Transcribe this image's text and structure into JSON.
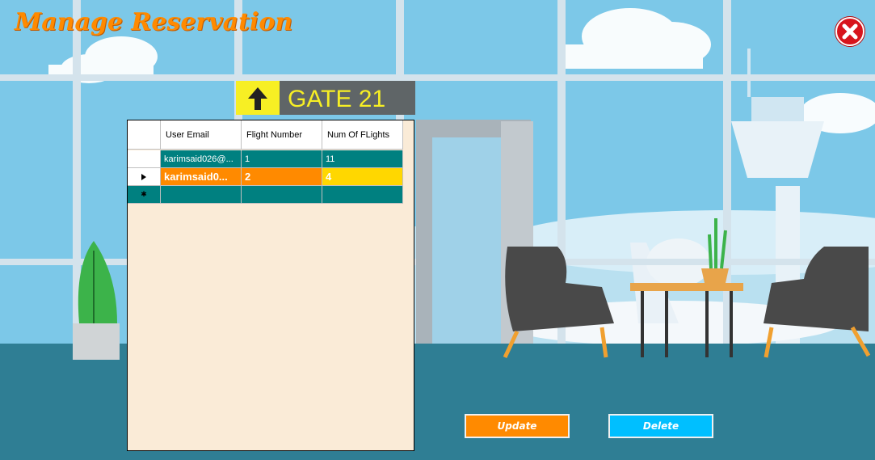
{
  "window": {
    "title": "Manage Reservation"
  },
  "background": {
    "gate_sign": "GATE 21"
  },
  "grid": {
    "columns": [
      "User Email",
      "Flight Number",
      "Num Of FLights"
    ],
    "rows": [
      {
        "email": "karimsaid026@...",
        "flight": "1",
        "num": "11"
      },
      {
        "email": "karimsaid0...",
        "flight": "2",
        "num": "4"
      }
    ]
  },
  "buttons": {
    "update": "Update",
    "delete": "Delete"
  },
  "colors": {
    "accent_orange": "#ff8a00",
    "grid_teal": "#008080",
    "delete_blue": "#00bfff",
    "close_red": "#d7141c",
    "panel_bg": "#faebd7"
  },
  "icons": {
    "close": "close-icon",
    "row_pointer": "row-pointer-icon",
    "new_row": "new-row-icon",
    "gate_arrow": "up-arrow-icon"
  }
}
